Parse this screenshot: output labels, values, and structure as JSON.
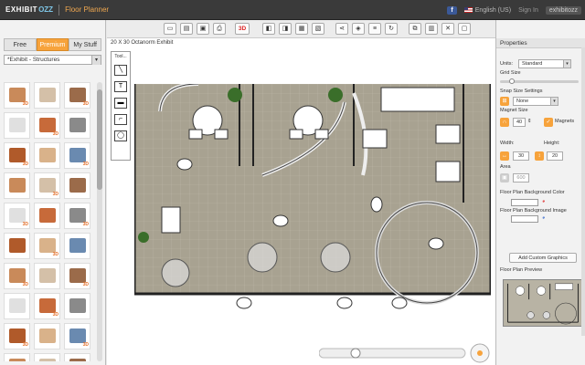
{
  "header": {
    "brand_exhibit": "EXHIBIT",
    "brand_ozz": "OZZ",
    "brand_app": "Floor Planner",
    "facebook_label": "f",
    "language": "English (US)",
    "signin": "Sign In",
    "right_logo": "exhibitozz"
  },
  "left_panel": {
    "tabs": [
      {
        "label": "Free",
        "active": false
      },
      {
        "label": "Premium",
        "active": true
      },
      {
        "label": "My Stuff",
        "active": false
      }
    ],
    "category": "*Exhibit - Structures",
    "thumbnail_badge": "3D"
  },
  "toolbar": {
    "mode_3d_label": "3D",
    "icons": [
      "new-file-icon",
      "open-file-icon",
      "save-icon",
      "print-icon",
      "3d-view-button",
      "bring-front-icon",
      "send-back-icon",
      "group-icon",
      "ungroup-icon",
      "share-icon",
      "layers-icon",
      "list-icon",
      "rotate-icon",
      "copy-icon",
      "paste-icon",
      "delete-icon",
      "lock-icon"
    ]
  },
  "canvas": {
    "title": "20 X 30 Octanorm Exhibit",
    "tool_palette_title": "Tool..."
  },
  "properties": {
    "heading": "Properties",
    "units_label": "Units:",
    "units_value": "Standard",
    "grid_size_label": "Grid Size",
    "snap_label": "Snap Size Settings",
    "snap_value": "None",
    "magnet_label": "Magnet Size",
    "magnet_value": "40",
    "magnets_label": "Magnets",
    "width_label": "Width:",
    "width_value": "30",
    "height_label": "Height:",
    "height_value": "20",
    "area_label": "Area",
    "area_value": "600",
    "bg_color_label": "Floor Plan Background Color",
    "bg_image_label": "Floor Plan Background Image",
    "add_graphics_label": "Add Custom Graphics",
    "preview_label": "Floor Plan Preview"
  },
  "colors": {
    "accent": "#f7a33c",
    "header_bg": "#3a3a3a",
    "floor_tile": "#a8a291",
    "wall": "#222222"
  }
}
